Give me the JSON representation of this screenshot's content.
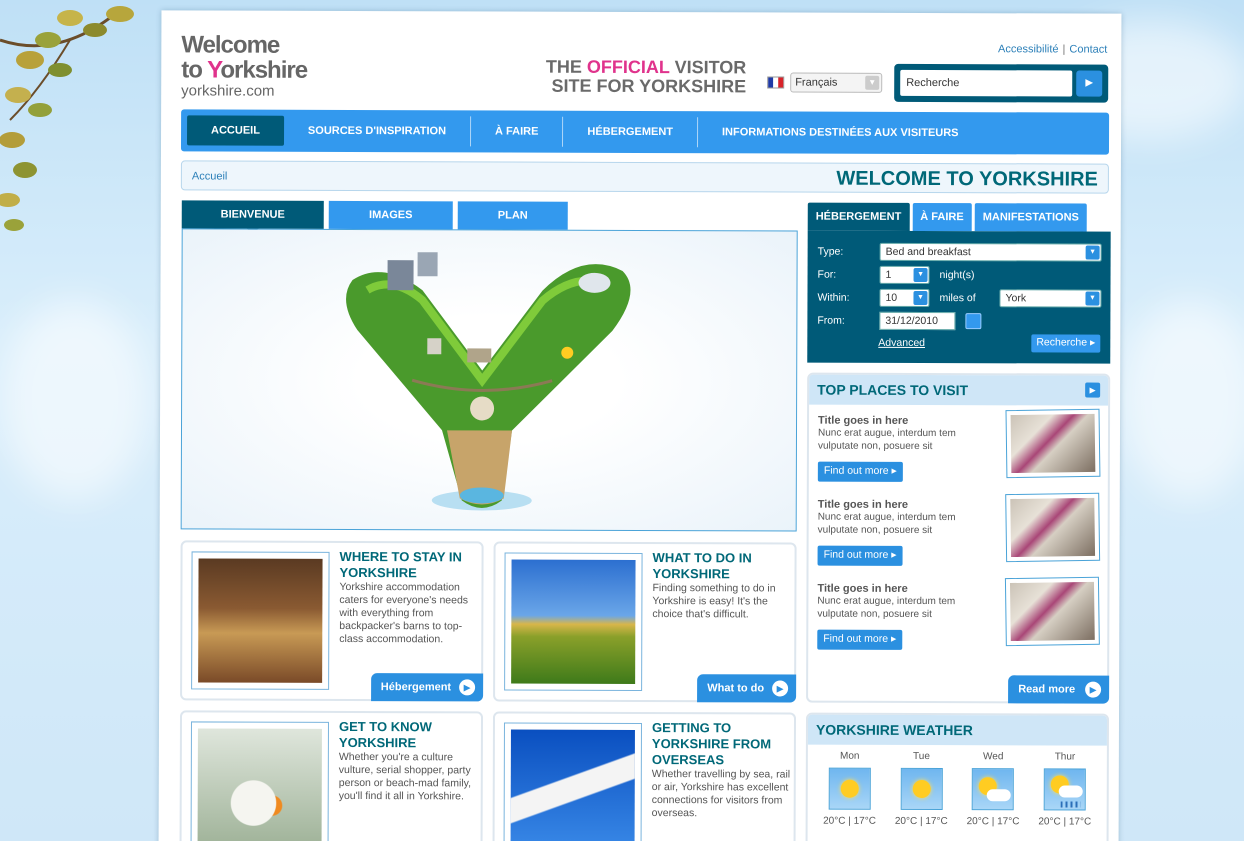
{
  "site": {
    "logo_line1": "Welcome",
    "logo_line2_a": "to ",
    "logo_line2_y": "Y",
    "logo_line2_b": "orkshire",
    "logo_url": "yorkshire.com",
    "tagline_the": "THE ",
    "tagline_official": "OFFICIAL",
    "tagline_visitor": " VISITOR",
    "tagline_line2": "SITE FOR YORKSHIRE"
  },
  "toplinks": {
    "accessibility": "Accessibilité",
    "separator": "|",
    "contact": "Contact"
  },
  "language": {
    "selected": "Français"
  },
  "search": {
    "value": "Recherche",
    "go_icon": "▶"
  },
  "nav": {
    "items": [
      {
        "label": "ACCUEIL"
      },
      {
        "label": "SOURCES D'INSPIRATION"
      },
      {
        "label": "À FAIRE"
      },
      {
        "label": "HÉBERGEMENT"
      },
      {
        "label": "INFORMATIONS DESTINÉES AUX VISITEURS"
      }
    ]
  },
  "breadcrumb": {
    "home": "Accueil",
    "page_title": "WELCOME TO YORKSHIRE"
  },
  "main_tabs": [
    {
      "label": "BIENVENUE"
    },
    {
      "label": "IMAGES"
    },
    {
      "label": "PLAN"
    }
  ],
  "cards": [
    {
      "title": "WHERE TO STAY IN YORKSHIRE",
      "text": "Yorkshire accommodation caters for everyone's needs with everything from backpacker's barns to top-class accommodation.",
      "button": "Hébergement"
    },
    {
      "title": "WHAT TO DO IN YORKSHIRE",
      "text": "Finding something to do in Yorkshire is easy! It's the choice that's difficult.",
      "button": "What to do"
    },
    {
      "title": "GET TO KNOW YORKSHIRE",
      "text": "Whether you're a culture vulture, serial shopper, party person or beach-mad family, you'll find it all in Yorkshire."
    },
    {
      "title": "GETTING TO YORKSHIRE FROM OVERSEAS",
      "text": "Whether travelling by sea, rail or air, Yorkshire has excellent connections for visitors from overseas."
    }
  ],
  "booking": {
    "tabs": [
      {
        "label": "HÉBERGEMENT"
      },
      {
        "label": "À FAIRE"
      },
      {
        "label": "MANIFESTATIONS"
      }
    ],
    "type_label": "Type:",
    "type_value": "Bed and breakfast",
    "for_label": "For:",
    "for_value": "1",
    "nights": "night(s)",
    "within_label": "Within:",
    "within_value": "10",
    "miles": "miles of",
    "place_value": "York",
    "from_label": "From:",
    "from_value": "31/12/2010",
    "advanced": "Advanced",
    "search_button": "Recherche"
  },
  "top_places": {
    "heading": "TOP PLACES TO VISIT",
    "items": [
      {
        "title": "Title goes in here",
        "text": "Nunc erat augue, interdum tem vulputate non, posuere sit",
        "button": "Find out more"
      },
      {
        "title": "Title goes in here",
        "text": "Nunc erat augue, interdum tem vulputate non, posuere sit",
        "button": "Find out more"
      },
      {
        "title": "Title goes in here",
        "text": "Nunc erat augue, interdum tem vulputate non, posuere sit",
        "button": "Find out more"
      }
    ],
    "read_more": "Read more"
  },
  "weather": {
    "heading": "YORKSHIRE WEATHER",
    "days": [
      {
        "day": "Mon",
        "temp": "20°C | 17°C",
        "icon": "sunny-icon"
      },
      {
        "day": "Tue",
        "temp": "20°C | 17°C",
        "icon": "sunny-icon"
      },
      {
        "day": "Wed",
        "temp": "20°C | 17°C",
        "icon": "partly-cloudy-icon"
      },
      {
        "day": "Thur",
        "temp": "20°C | 17°C",
        "icon": "rain-icon"
      }
    ]
  },
  "colors": {
    "teal": "#005a78",
    "blue": "#3399ee",
    "pink": "#e0338c",
    "heading": "#006878"
  }
}
